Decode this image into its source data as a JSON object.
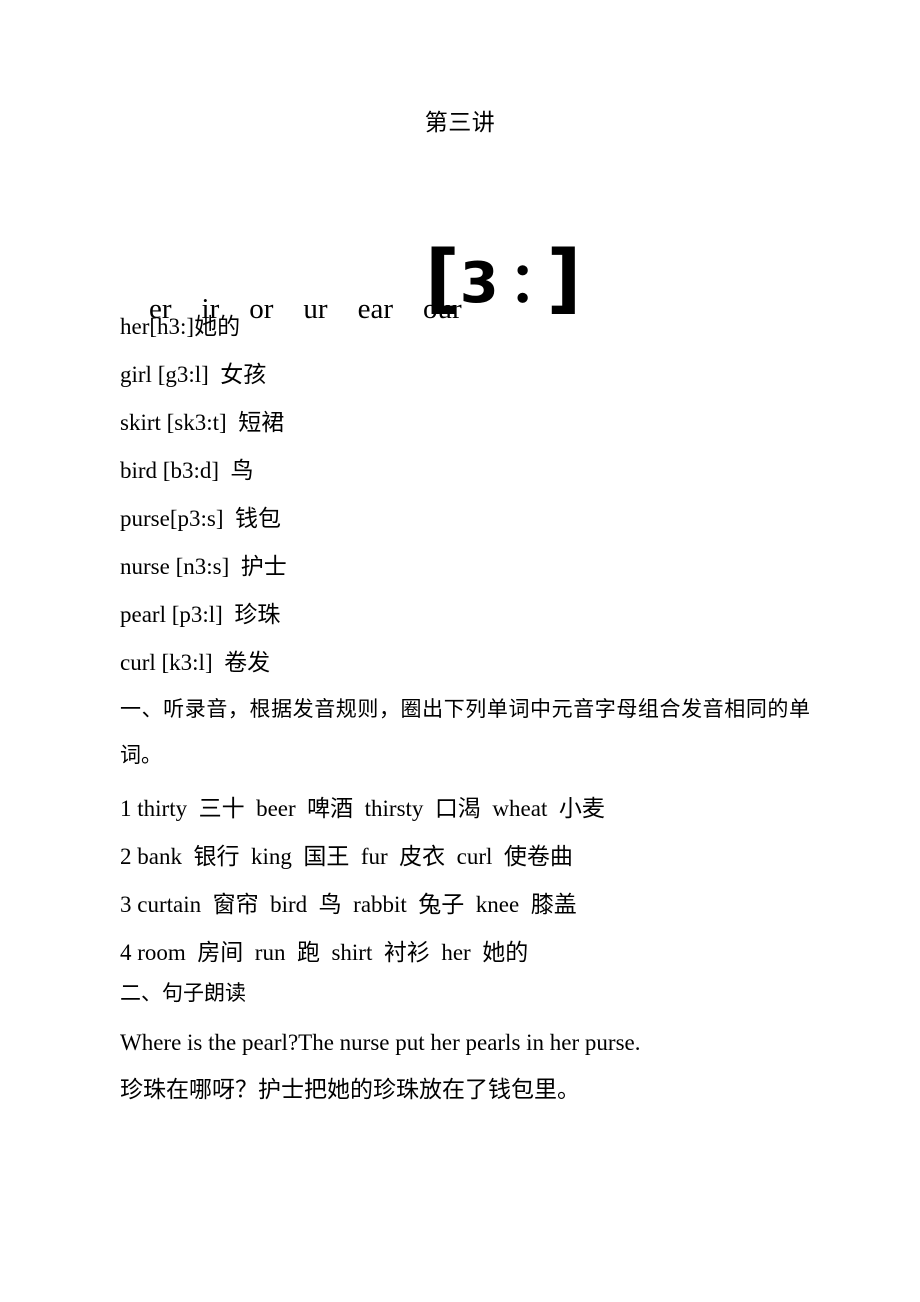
{
  "document": {
    "title": "第三讲",
    "phonetic": {
      "open_bracket": "[",
      "symbol": "3",
      "length_mark": "：",
      "close_bracket": "]"
    },
    "spelling_patterns": [
      "er",
      "ir",
      "or",
      "ur",
      "ear",
      "our"
    ],
    "word_list": [
      "her[h3:]她的",
      "girl [g3:l]  女孩",
      "skirt [sk3:t]  短裙",
      "bird [b3:d]  鸟",
      "purse[p3:s]  钱包",
      "nurse [n3:s]  护士",
      "pearl [p3:l]  珍珠",
      "curl [k3:l]  卷发"
    ],
    "section_one": {
      "heading": "一、听录音，根据发音规则，圈出下列单词中元音字母组合发音相同的单词。",
      "items": [
        "1 thirty  三十  beer  啤酒  thirsty  口渴  wheat  小麦",
        "2 bank  银行  king  国王  fur  皮衣  curl  使卷曲",
        "3 curtain  窗帘  bird  鸟  rabbit  兔子  knee  膝盖",
        "4 room  房间  run  跑  shirt  衬衫  her  她的"
      ]
    },
    "section_two": {
      "heading": "二、句子朗读",
      "sentence_english": "Where is the pearl?The nurse put her pearls in her purse.",
      "sentence_chinese": "珍珠在哪呀？护士把她的珍珠放在了钱包里。"
    },
    "colors": {
      "page_background": "#ffffff",
      "text": "#000000"
    }
  }
}
